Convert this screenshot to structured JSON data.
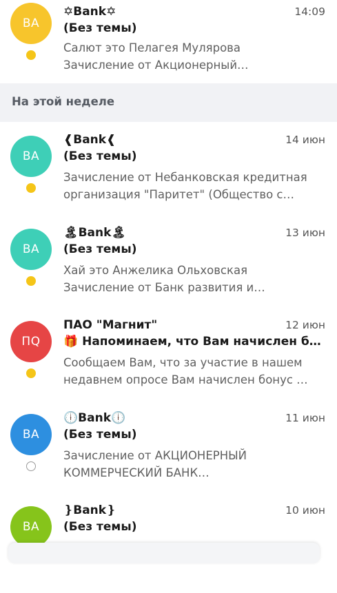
{
  "colors": {
    "unread_dot": "#f5c518",
    "section_bg": "#f1f2f5"
  },
  "sections": {
    "this_week": "На этой неделе"
  },
  "emails": [
    {
      "avatar_text": "BA",
      "avatar_color": "#f7c52c",
      "sender": "✡Bank✡",
      "date": "14:09",
      "subject": "(Без темы)",
      "snippet_lines": [
        "Салют это Пелагея Мулярова",
        "Зачисление от Акционерный…"
      ],
      "unread": true
    },
    {
      "avatar_text": "BA",
      "avatar_color": "#3ecfb7",
      "sender": "❰Bank❰",
      "date": "14 июн",
      "subject": "(Без темы)",
      "snippet_lines": [
        "Зачисление от Небанковская кредитная",
        "организация \"Паритет\" (Общество с…"
      ],
      "unread": true
    },
    {
      "avatar_text": "BA",
      "avatar_color": "#3ecfb7",
      "sender": "🏝Bank🏝",
      "date": "13 июн",
      "subject": "(Без темы)",
      "snippet_lines": [
        "Хай это Анжелика Ольховская",
        "Зачисление от Банк развития и…"
      ],
      "unread": true
    },
    {
      "avatar_text": "ПQ",
      "avatar_color": "#e64545",
      "sender": "ПАО \"Магнит\"",
      "date": "12 июн",
      "subject": "🎁 Напоминаем, что Вам начислен бону…",
      "snippet_lines": [
        "Сообщаем Вам, что за участие в нашем",
        "недавнем опросе Вам начислен бонус …"
      ],
      "unread": true
    },
    {
      "avatar_text": "BA",
      "avatar_color": "#2d8fe0",
      "sender": "🕕Bank🕕",
      "date": "11 июн",
      "subject": "(Без темы)",
      "snippet_lines": [
        "Зачисление от АКЦИОНЕРНЫЙ",
        "КОММЕРЧЕСКИЙ БАНК…"
      ],
      "unread": false
    },
    {
      "avatar_text": "BA",
      "avatar_color": "#86c41b",
      "sender": "❵Bank❵",
      "date": "10 июн",
      "subject": "(Без темы)",
      "snippet_lines": [],
      "unread": true
    }
  ]
}
